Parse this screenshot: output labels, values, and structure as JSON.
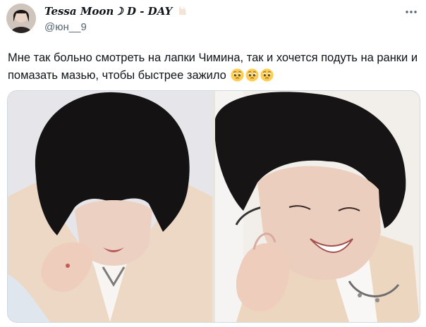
{
  "tweet": {
    "display_name": "Tessa Moon☽ D - DAY",
    "handle": "@юн__9",
    "text": "Мне так больно смотреть на лапки Чимина, так и хочется подуть на ранки и помазать мазью, чтобы быстрее зажило",
    "emojis": [
      "pleading-face",
      "pleading-face",
      "pleading-face"
    ]
  },
  "icons": {
    "more": "more-horizontal-icon",
    "name_emoji": "nail-emoji"
  },
  "colors": {
    "text": "#0f1419",
    "secondary": "#536471",
    "border": "#cfd9de"
  }
}
